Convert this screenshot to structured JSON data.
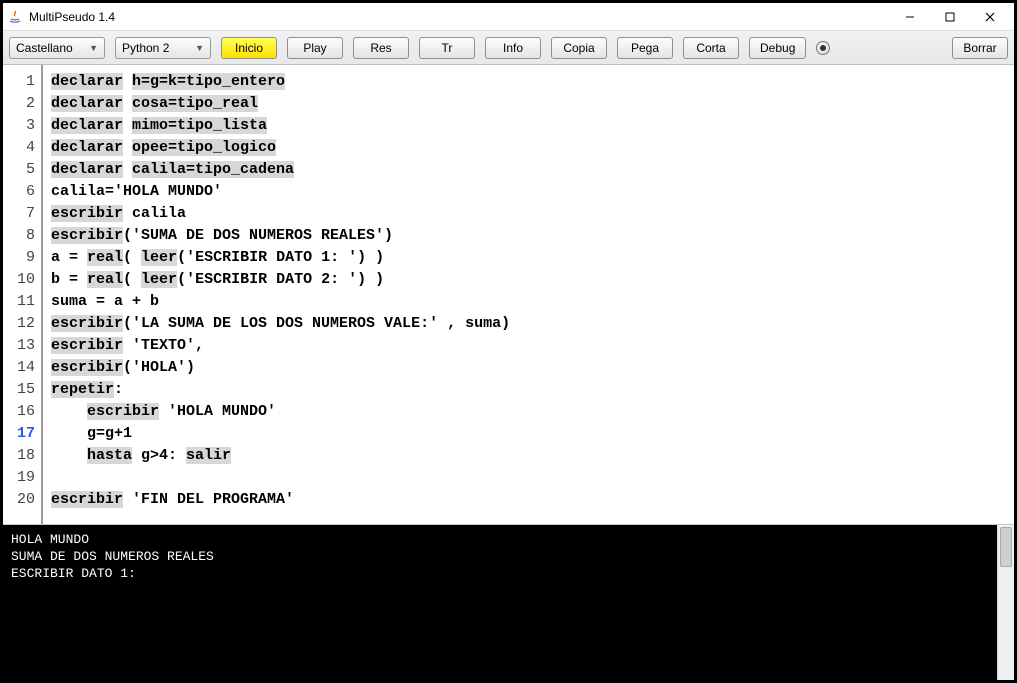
{
  "window": {
    "title": "MultiPseudo 1.4"
  },
  "toolbar": {
    "combo_lang": "Castellano",
    "combo_python": "Python 2",
    "btn_inicio": "Inicio",
    "btn_play": "Play",
    "btn_res": "Res",
    "btn_tr": "Tr",
    "btn_info": "Info",
    "btn_copia": "Copia",
    "btn_pega": "Pega",
    "btn_corta": "Corta",
    "btn_debug": "Debug",
    "btn_borrar": "Borrar"
  },
  "editor": {
    "active_line": 17,
    "lines": [
      {
        "n": 1,
        "segs": [
          [
            "kw",
            "declarar"
          ],
          [
            "",
            " "
          ],
          [
            "kw",
            "h=g=k=tipo_entero"
          ]
        ]
      },
      {
        "n": 2,
        "segs": [
          [
            "kw",
            "declarar"
          ],
          [
            "",
            " "
          ],
          [
            "kw",
            "cosa=tipo_real"
          ]
        ]
      },
      {
        "n": 3,
        "segs": [
          [
            "kw",
            "declarar"
          ],
          [
            "",
            " "
          ],
          [
            "kw",
            "mimo=tipo_lista"
          ]
        ]
      },
      {
        "n": 4,
        "segs": [
          [
            "kw",
            "declarar"
          ],
          [
            "",
            " "
          ],
          [
            "kw",
            "opee=tipo_logico"
          ]
        ]
      },
      {
        "n": 5,
        "segs": [
          [
            "kw",
            "declarar"
          ],
          [
            "",
            " "
          ],
          [
            "kw",
            "calila=tipo_cadena"
          ]
        ]
      },
      {
        "n": 6,
        "segs": [
          [
            "",
            "calila='HOLA MUNDO'"
          ]
        ]
      },
      {
        "n": 7,
        "segs": [
          [
            "kw",
            "escribir"
          ],
          [
            "",
            " calila"
          ]
        ]
      },
      {
        "n": 8,
        "segs": [
          [
            "kw",
            "escribir"
          ],
          [
            "",
            "('SUMA DE DOS NUMEROS REALES')"
          ]
        ]
      },
      {
        "n": 9,
        "segs": [
          [
            "",
            "a = "
          ],
          [
            "kw",
            "real"
          ],
          [
            "",
            "( "
          ],
          [
            "kw",
            "leer"
          ],
          [
            "",
            "('ESCRIBIR DATO 1: ') )"
          ]
        ]
      },
      {
        "n": 10,
        "segs": [
          [
            "",
            "b = "
          ],
          [
            "kw",
            "real"
          ],
          [
            "",
            "( "
          ],
          [
            "kw",
            "leer"
          ],
          [
            "",
            "('ESCRIBIR DATO 2: ') )"
          ]
        ]
      },
      {
        "n": 11,
        "segs": [
          [
            "",
            "suma = a + b"
          ]
        ]
      },
      {
        "n": 12,
        "segs": [
          [
            "kw",
            "escribir"
          ],
          [
            "",
            "('LA SUMA DE LOS DOS NUMEROS VALE:' , suma)"
          ]
        ]
      },
      {
        "n": 13,
        "segs": [
          [
            "kw",
            "escribir"
          ],
          [
            "",
            " 'TEXTO',"
          ]
        ]
      },
      {
        "n": 14,
        "segs": [
          [
            "kw",
            "escribir"
          ],
          [
            "",
            "('HOLA')"
          ]
        ]
      },
      {
        "n": 15,
        "segs": [
          [
            "kw",
            "repetir"
          ],
          [
            "",
            ":"
          ]
        ]
      },
      {
        "n": 16,
        "segs": [
          [
            "",
            "    "
          ],
          [
            "kw",
            "escribir"
          ],
          [
            "",
            " 'HOLA MUNDO'"
          ]
        ]
      },
      {
        "n": 17,
        "segs": [
          [
            "",
            "    g=g+1"
          ]
        ]
      },
      {
        "n": 18,
        "segs": [
          [
            "",
            "    "
          ],
          [
            "kw",
            "hasta"
          ],
          [
            "",
            " g>4: "
          ],
          [
            "kw",
            "salir"
          ]
        ]
      },
      {
        "n": 19,
        "segs": [
          [
            "",
            ""
          ]
        ]
      },
      {
        "n": 20,
        "segs": [
          [
            "kw",
            "escribir"
          ],
          [
            "",
            " 'FIN DEL PROGRAMA'"
          ]
        ]
      }
    ]
  },
  "console": {
    "lines": [
      "HOLA MUNDO",
      "SUMA DE DOS NUMEROS REALES",
      "ESCRIBIR DATO 1:"
    ]
  }
}
